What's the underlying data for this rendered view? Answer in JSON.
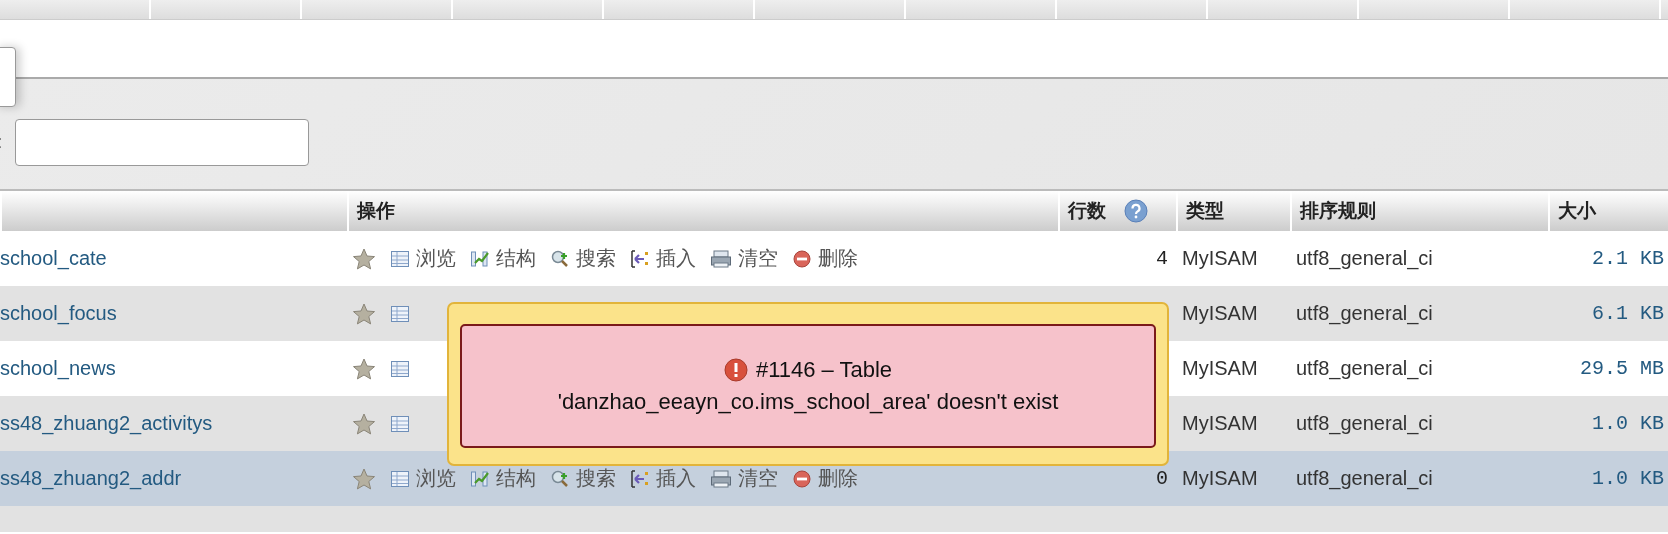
{
  "filter": {
    "label": ":"
  },
  "table": {
    "columns": [
      {
        "kind": "name"
      },
      {
        "kind": "plain",
        "label": "操作"
      },
      {
        "kind": "help",
        "label": "行数"
      },
      {
        "kind": "plain",
        "label": "类型"
      },
      {
        "kind": "plain",
        "label": "排序规则"
      },
      {
        "kind": "plain",
        "label": "大小"
      }
    ],
    "rows": [
      {
        "name": "school_cate",
        "selected": false,
        "actions": [
          {
            "kind": "browse",
            "label": "浏览"
          },
          {
            "kind": "structure",
            "label": "结构"
          },
          {
            "kind": "search",
            "label": "搜索"
          },
          {
            "kind": "insert",
            "label": "插入"
          },
          {
            "kind": "empty",
            "label": "清空"
          },
          {
            "kind": "drop",
            "label": "删除"
          }
        ],
        "rows": "4",
        "type": "MyISAM",
        "collation": "utf8_general_ci",
        "size": "2.1 KB"
      },
      {
        "name": "school_focus",
        "selected": false,
        "actions": [
          {
            "kind": "browse"
          }
        ],
        "type": "MyISAM",
        "collation": "utf8_general_ci",
        "size": "6.1 KB"
      },
      {
        "name": "school_news",
        "selected": false,
        "actions": [
          {
            "kind": "browse"
          }
        ],
        "type": "MyISAM",
        "collation": "utf8_general_ci",
        "size": "29.5 MB"
      },
      {
        "name": "ss48_zhuang2_activitys",
        "selected": false,
        "actions": [
          {
            "kind": "browse"
          }
        ],
        "type": "MyISAM",
        "collation": "utf8_general_ci",
        "size": "1.0 KB"
      },
      {
        "name": "ss48_zhuang2_addr",
        "selected": true,
        "actions": [
          {
            "kind": "browse",
            "label": "浏览"
          },
          {
            "kind": "structure",
            "label": "结构"
          },
          {
            "kind": "search",
            "label": "搜索"
          },
          {
            "kind": "insert",
            "label": "插入"
          },
          {
            "kind": "empty",
            "label": "清空"
          },
          {
            "kind": "drop",
            "label": "删除"
          }
        ],
        "rows": "0",
        "type": "MyISAM",
        "collation": "utf8_general_ci",
        "size": "1.0 KB"
      }
    ]
  },
  "error": {
    "title": "#1146 – Table",
    "message": "'danzhao_eeayn_co.ims_school_area' doesn't exist"
  }
}
